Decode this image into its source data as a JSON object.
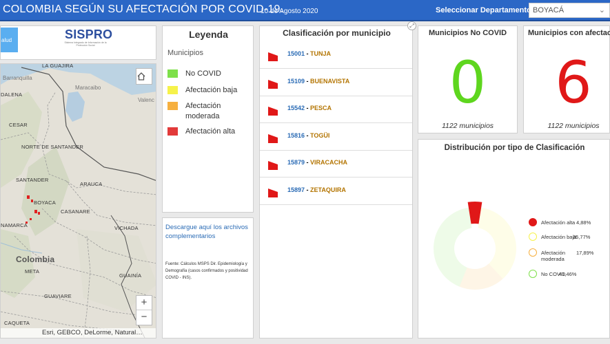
{
  "header": {
    "title": "COLOMBIA SEGÚN SU AFECTACIÓN POR COVID-19.",
    "date": "10 de Agosto 2020",
    "select_label": "Seleccionar Departamento",
    "select_value": "BOYACÁ",
    "bg_color": "#2b67c6"
  },
  "logos": {
    "salud_button": "alud",
    "sispro": "SISPRO",
    "sispro_sub": "Sistema Integrado de Información de la Protección Social"
  },
  "map": {
    "labels": {
      "guajira": "LA GUAJIRA",
      "magdalena": "DALENA",
      "barranquilla": "Barranquilla",
      "maracaibo": "Maracaibo",
      "valencia": "Valenc",
      "cesar": "CESAR",
      "norte_santander": "NORTE DE SANTANDER",
      "santander": "SANTANDER",
      "arauca": "ARAUCA",
      "boyaca": "BOYACA",
      "casanare": "CASANARE",
      "vichada": "VICHADA",
      "cundinamarca": "NAMARCA",
      "colombia": "Colombia",
      "meta": "META",
      "guainia": "GUAINÍA",
      "guaviare": "GUAVIARE",
      "caqueta": "CAQUETA"
    },
    "home_icon": "home-icon",
    "zoom_in": "+",
    "zoom_out": "−",
    "attribution": "Esri, GEBCO, DeLorme, Natural…",
    "highlight_color": "#e02020"
  },
  "legend": {
    "title": "Leyenda",
    "subtitle": "Municipios",
    "items": [
      {
        "label": "No COVID",
        "color": "#7ee04a"
      },
      {
        "label": "Afectación baja",
        "color": "#f6f24a"
      },
      {
        "label": "Afectación moderada",
        "color": "#f6b040"
      },
      {
        "label": "Afectación alta",
        "color": "#e23a3a"
      }
    ]
  },
  "download": {
    "link": "Descargue aquí los archivos complementarios",
    "source": "Fuente: Cálculos MSPS Dir. Epidemiología y Demografía (casos confirmados y positividad COVID - INS)."
  },
  "classification": {
    "title": "Clasificación por municipio",
    "expand_icon": "expand-icon",
    "rows": [
      {
        "code": "15001",
        "name": "TUNJA"
      },
      {
        "code": "15109",
        "name": "BUENAVISTA"
      },
      {
        "code": "15542",
        "name": "PESCA"
      },
      {
        "code": "15816",
        "name": "TOGÜI"
      },
      {
        "code": "15879",
        "name": "VIRACACHA"
      },
      {
        "code": "15897",
        "name": "ZETAQUIRA"
      }
    ]
  },
  "kpi": {
    "no_covid": {
      "title": "Municipios No COVID",
      "value": "0",
      "footer": "1122 municipios",
      "color": "#5ed61e"
    },
    "afectacion": {
      "title": "Municipios con afectación",
      "value": "6",
      "footer": "1122 municipios",
      "color": "#e01818"
    }
  },
  "chart_data": {
    "type": "pie",
    "title": "Distribución por tipo de Clasificación",
    "series": [
      {
        "name": "Afectación alta",
        "value": 4.88,
        "label": "4,88%",
        "color": "#e01818"
      },
      {
        "name": "Afectación baja",
        "value": 35.77,
        "label": "35,77%",
        "color": "#f6f24a"
      },
      {
        "name": "Afectación moderada",
        "value": 17.89,
        "label": "17,89%",
        "color": "#f6b040"
      },
      {
        "name": "No COVID",
        "value": 41.46,
        "label": "41,46%",
        "color": "#7ee04a"
      }
    ],
    "legend_position": "right"
  }
}
